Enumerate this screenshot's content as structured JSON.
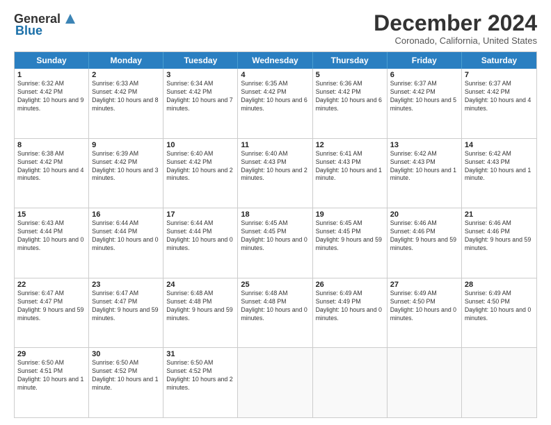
{
  "header": {
    "logo_general": "General",
    "logo_blue": "Blue",
    "month_title": "December 2024",
    "location": "Coronado, California, United States"
  },
  "days_of_week": [
    "Sunday",
    "Monday",
    "Tuesday",
    "Wednesday",
    "Thursday",
    "Friday",
    "Saturday"
  ],
  "rows": [
    [
      {
        "day": "1",
        "sunrise": "Sunrise: 6:32 AM",
        "sunset": "Sunset: 4:42 PM",
        "daylight": "Daylight: 10 hours and 9 minutes."
      },
      {
        "day": "2",
        "sunrise": "Sunrise: 6:33 AM",
        "sunset": "Sunset: 4:42 PM",
        "daylight": "Daylight: 10 hours and 8 minutes."
      },
      {
        "day": "3",
        "sunrise": "Sunrise: 6:34 AM",
        "sunset": "Sunset: 4:42 PM",
        "daylight": "Daylight: 10 hours and 7 minutes."
      },
      {
        "day": "4",
        "sunrise": "Sunrise: 6:35 AM",
        "sunset": "Sunset: 4:42 PM",
        "daylight": "Daylight: 10 hours and 6 minutes."
      },
      {
        "day": "5",
        "sunrise": "Sunrise: 6:36 AM",
        "sunset": "Sunset: 4:42 PM",
        "daylight": "Daylight: 10 hours and 6 minutes."
      },
      {
        "day": "6",
        "sunrise": "Sunrise: 6:37 AM",
        "sunset": "Sunset: 4:42 PM",
        "daylight": "Daylight: 10 hours and 5 minutes."
      },
      {
        "day": "7",
        "sunrise": "Sunrise: 6:37 AM",
        "sunset": "Sunset: 4:42 PM",
        "daylight": "Daylight: 10 hours and 4 minutes."
      }
    ],
    [
      {
        "day": "8",
        "sunrise": "Sunrise: 6:38 AM",
        "sunset": "Sunset: 4:42 PM",
        "daylight": "Daylight: 10 hours and 4 minutes."
      },
      {
        "day": "9",
        "sunrise": "Sunrise: 6:39 AM",
        "sunset": "Sunset: 4:42 PM",
        "daylight": "Daylight: 10 hours and 3 minutes."
      },
      {
        "day": "10",
        "sunrise": "Sunrise: 6:40 AM",
        "sunset": "Sunset: 4:42 PM",
        "daylight": "Daylight: 10 hours and 2 minutes."
      },
      {
        "day": "11",
        "sunrise": "Sunrise: 6:40 AM",
        "sunset": "Sunset: 4:43 PM",
        "daylight": "Daylight: 10 hours and 2 minutes."
      },
      {
        "day": "12",
        "sunrise": "Sunrise: 6:41 AM",
        "sunset": "Sunset: 4:43 PM",
        "daylight": "Daylight: 10 hours and 1 minute."
      },
      {
        "day": "13",
        "sunrise": "Sunrise: 6:42 AM",
        "sunset": "Sunset: 4:43 PM",
        "daylight": "Daylight: 10 hours and 1 minute."
      },
      {
        "day": "14",
        "sunrise": "Sunrise: 6:42 AM",
        "sunset": "Sunset: 4:43 PM",
        "daylight": "Daylight: 10 hours and 1 minute."
      }
    ],
    [
      {
        "day": "15",
        "sunrise": "Sunrise: 6:43 AM",
        "sunset": "Sunset: 4:44 PM",
        "daylight": "Daylight: 10 hours and 0 minutes."
      },
      {
        "day": "16",
        "sunrise": "Sunrise: 6:44 AM",
        "sunset": "Sunset: 4:44 PM",
        "daylight": "Daylight: 10 hours and 0 minutes."
      },
      {
        "day": "17",
        "sunrise": "Sunrise: 6:44 AM",
        "sunset": "Sunset: 4:44 PM",
        "daylight": "Daylight: 10 hours and 0 minutes."
      },
      {
        "day": "18",
        "sunrise": "Sunrise: 6:45 AM",
        "sunset": "Sunset: 4:45 PM",
        "daylight": "Daylight: 10 hours and 0 minutes."
      },
      {
        "day": "19",
        "sunrise": "Sunrise: 6:45 AM",
        "sunset": "Sunset: 4:45 PM",
        "daylight": "Daylight: 9 hours and 59 minutes."
      },
      {
        "day": "20",
        "sunrise": "Sunrise: 6:46 AM",
        "sunset": "Sunset: 4:46 PM",
        "daylight": "Daylight: 9 hours and 59 minutes."
      },
      {
        "day": "21",
        "sunrise": "Sunrise: 6:46 AM",
        "sunset": "Sunset: 4:46 PM",
        "daylight": "Daylight: 9 hours and 59 minutes."
      }
    ],
    [
      {
        "day": "22",
        "sunrise": "Sunrise: 6:47 AM",
        "sunset": "Sunset: 4:47 PM",
        "daylight": "Daylight: 9 hours and 59 minutes."
      },
      {
        "day": "23",
        "sunrise": "Sunrise: 6:47 AM",
        "sunset": "Sunset: 4:47 PM",
        "daylight": "Daylight: 9 hours and 59 minutes."
      },
      {
        "day": "24",
        "sunrise": "Sunrise: 6:48 AM",
        "sunset": "Sunset: 4:48 PM",
        "daylight": "Daylight: 9 hours and 59 minutes."
      },
      {
        "day": "25",
        "sunrise": "Sunrise: 6:48 AM",
        "sunset": "Sunset: 4:48 PM",
        "daylight": "Daylight: 10 hours and 0 minutes."
      },
      {
        "day": "26",
        "sunrise": "Sunrise: 6:49 AM",
        "sunset": "Sunset: 4:49 PM",
        "daylight": "Daylight: 10 hours and 0 minutes."
      },
      {
        "day": "27",
        "sunrise": "Sunrise: 6:49 AM",
        "sunset": "Sunset: 4:50 PM",
        "daylight": "Daylight: 10 hours and 0 minutes."
      },
      {
        "day": "28",
        "sunrise": "Sunrise: 6:49 AM",
        "sunset": "Sunset: 4:50 PM",
        "daylight": "Daylight: 10 hours and 0 minutes."
      }
    ],
    [
      {
        "day": "29",
        "sunrise": "Sunrise: 6:50 AM",
        "sunset": "Sunset: 4:51 PM",
        "daylight": "Daylight: 10 hours and 1 minute."
      },
      {
        "day": "30",
        "sunrise": "Sunrise: 6:50 AM",
        "sunset": "Sunset: 4:52 PM",
        "daylight": "Daylight: 10 hours and 1 minute."
      },
      {
        "day": "31",
        "sunrise": "Sunrise: 6:50 AM",
        "sunset": "Sunset: 4:52 PM",
        "daylight": "Daylight: 10 hours and 2 minutes."
      },
      null,
      null,
      null,
      null
    ]
  ]
}
